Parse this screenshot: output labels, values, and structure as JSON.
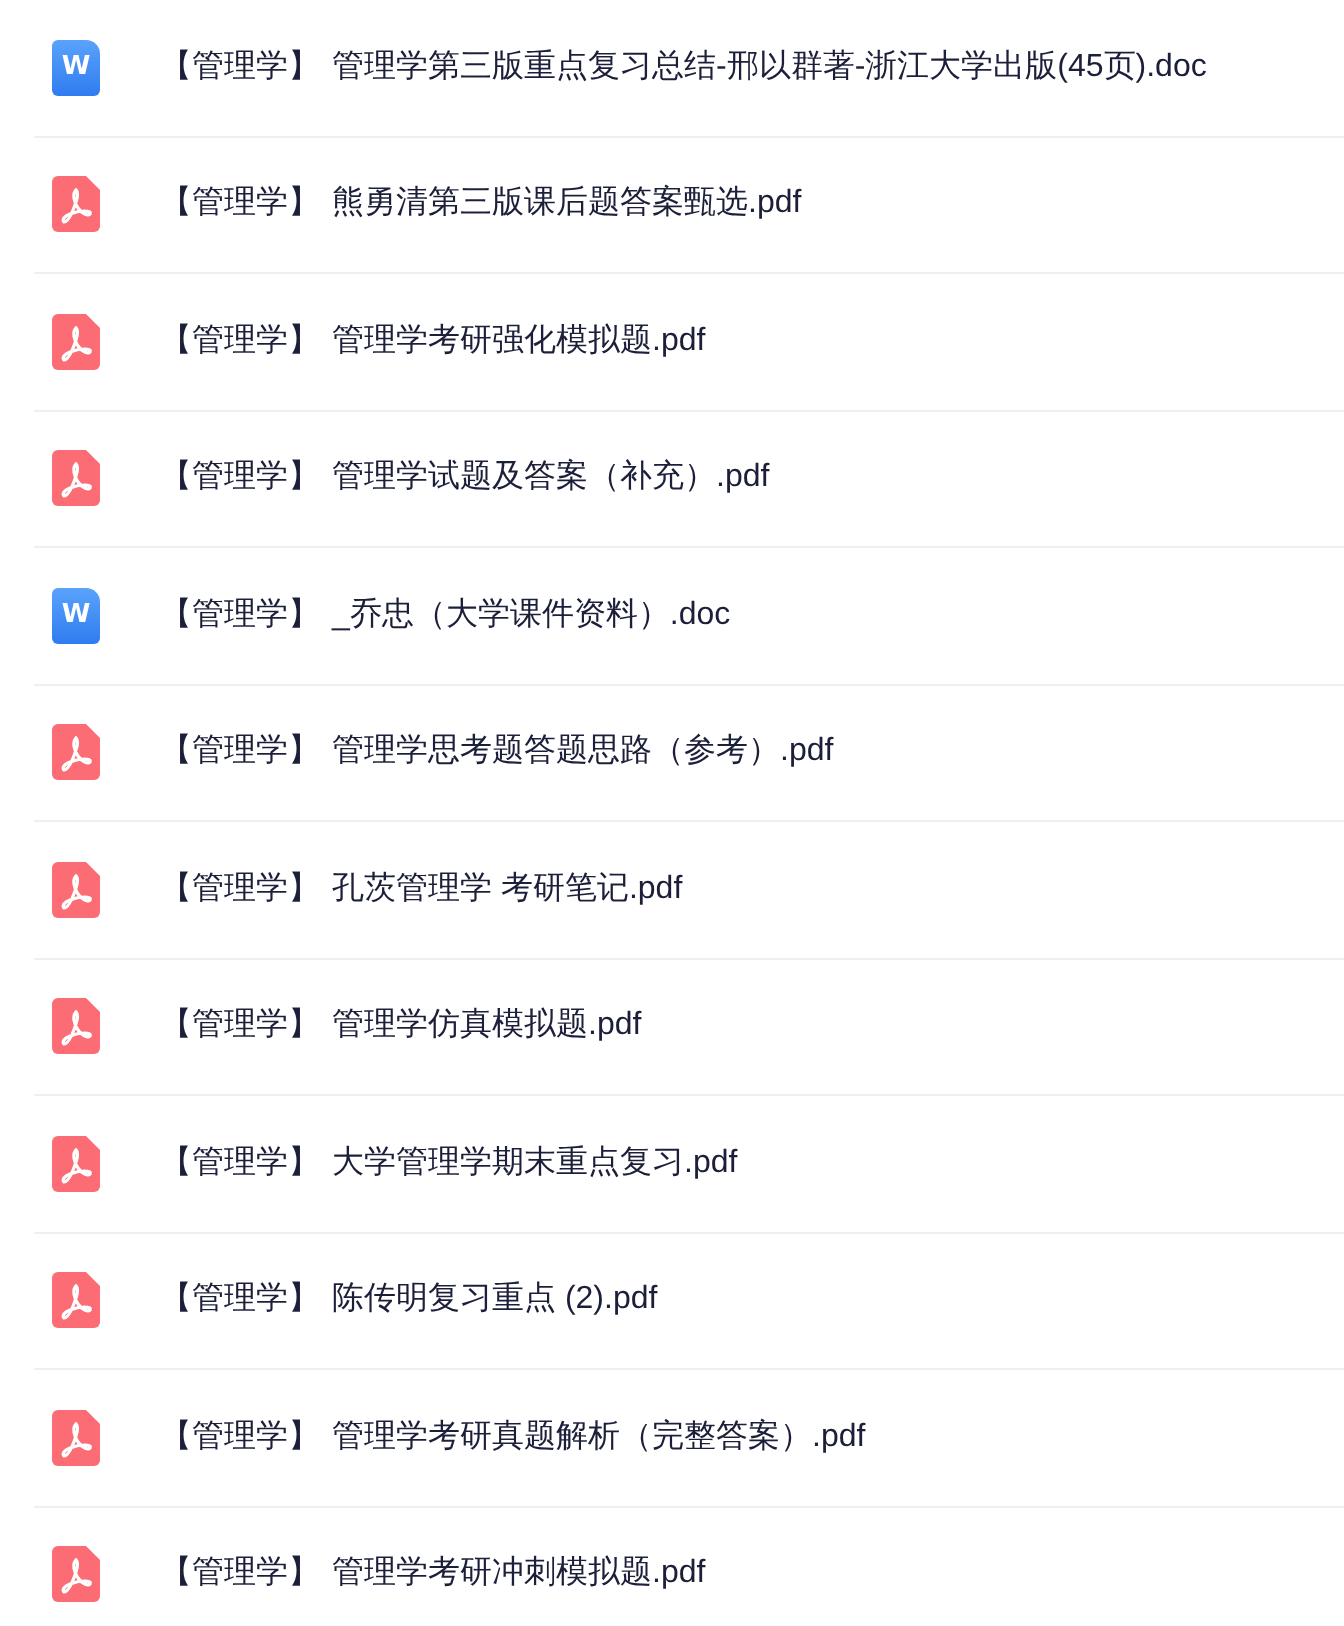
{
  "files": [
    {
      "kind": "doc",
      "badge": "W",
      "tag": "【管理学】",
      "name": "管理学第三版重点复习总结-邢以群著-浙江大学出版(45页).doc"
    },
    {
      "kind": "pdf",
      "tag": "【管理学】",
      "name": "熊勇清第三版课后题答案甄选.pdf"
    },
    {
      "kind": "pdf",
      "tag": "【管理学】",
      "name": "管理学考研强化模拟题.pdf"
    },
    {
      "kind": "pdf",
      "tag": "【管理学】",
      "name": "管理学试题及答案（补充）.pdf"
    },
    {
      "kind": "doc",
      "badge": "W",
      "tag": "【管理学】",
      "name": "_乔忠（大学课件资料）.doc"
    },
    {
      "kind": "pdf",
      "tag": "【管理学】",
      "name": "管理学思考题答题思路（参考）.pdf"
    },
    {
      "kind": "pdf",
      "tag": "【管理学】",
      "name": "孔茨管理学 考研笔记.pdf"
    },
    {
      "kind": "pdf",
      "tag": "【管理学】",
      "name": "管理学仿真模拟题.pdf"
    },
    {
      "kind": "pdf",
      "tag": "【管理学】",
      "name": "大学管理学期末重点复习.pdf"
    },
    {
      "kind": "pdf",
      "tag": "【管理学】",
      "name": "陈传明复习重点 (2).pdf"
    },
    {
      "kind": "pdf",
      "tag": "【管理学】",
      "name": "管理学考研真题解析（完整答案）.pdf"
    },
    {
      "kind": "pdf",
      "tag": "【管理学】",
      "name": "管理学考研冲刺模拟题.pdf"
    }
  ]
}
